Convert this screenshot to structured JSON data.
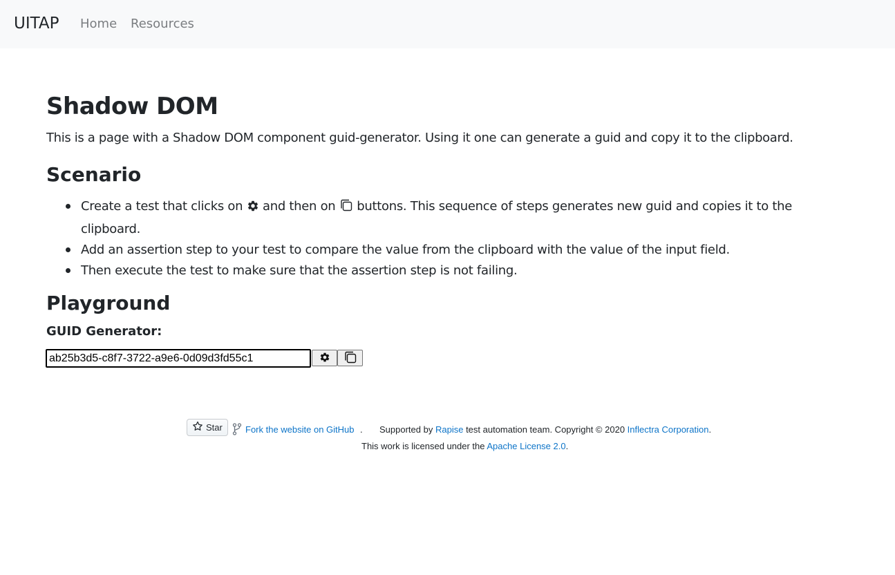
{
  "navbar": {
    "brand": "UITAP",
    "links": [
      {
        "label": "Home"
      },
      {
        "label": "Resources"
      }
    ]
  },
  "page": {
    "title": "Shadow DOM",
    "intro": "This is a page with a Shadow DOM component guid-generator. Using it one can generate a guid and copy it to the clipboard."
  },
  "scenario": {
    "heading": "Scenario",
    "steps": [
      {
        "part1": "Create a test that clicks on",
        "part2": "and then on",
        "part3": "buttons. This sequence of steps generates new guid and copies it to the clipboard."
      },
      {
        "text": "Add an assertion step to your test to compare the value from the clipboard with the value of the input field."
      },
      {
        "text": "Then execute the test to make sure that the assertion step is not failing."
      }
    ],
    "icons": [
      "gear-icon",
      "copy-icon"
    ]
  },
  "playground": {
    "heading": "Playground",
    "label": "GUID Generator:",
    "guid_value": "ab25b3d5-c8f7-3722-a9e6-0d09d3fd55c1",
    "buttons": [
      {
        "icon": "gear-icon"
      },
      {
        "icon": "copy-icon"
      }
    ]
  },
  "footer": {
    "star_label": "Star",
    "fork_text": "Fork the website on GitHub",
    "fork_suffix": ".",
    "supported_by": "Supported by",
    "rapise": "Rapise",
    "team_copyright": "test automation team. Copyright © 2020",
    "inflectra": "Inflectra Corporation",
    "period": ".",
    "license_prefix": "This work is licensed under the",
    "license_link": "Apache License 2.0",
    "license_suffix": "."
  },
  "colors": {
    "navbar_bg": "#f8f9fa",
    "link": "#0d74c8",
    "text": "#212529",
    "nav_muted": "#7a7d80"
  }
}
